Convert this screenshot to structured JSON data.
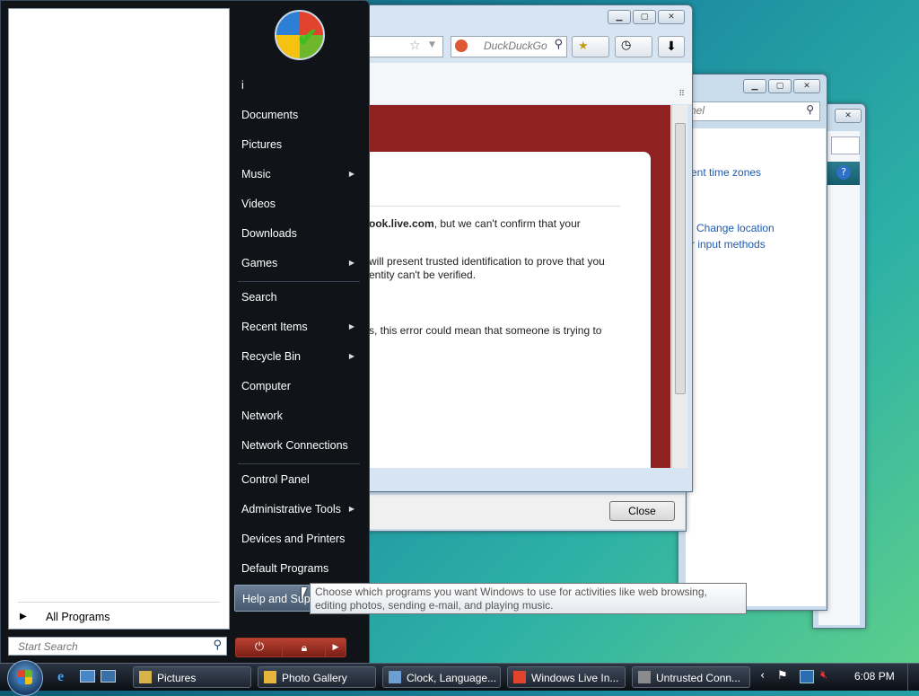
{
  "browser": {
    "search_placeholder": "DuckDuckGo",
    "cert_text_1_bold": "ook.live.com",
    "cert_text_1_rest": ", but we can't confirm that your",
    "cert_text_2": "will present trusted identification to prove that you",
    "cert_text_3": "entity can't be verified.",
    "cert_text_4": "s, this error could mean that someone is trying to"
  },
  "dialog": {
    "search_hint": "nel",
    "link_timezones": "ent time zones",
    "link_change_location": "Change location",
    "link_input_methods": "r input methods",
    "close_label": "Close"
  },
  "start_menu": {
    "user": "i",
    "items": [
      {
        "label": "Documents",
        "arrow": false
      },
      {
        "label": "Pictures",
        "arrow": false
      },
      {
        "label": "Music",
        "arrow": true
      },
      {
        "label": "Videos",
        "arrow": false
      },
      {
        "label": "Downloads",
        "arrow": false
      },
      {
        "label": "Games",
        "arrow": true
      },
      {
        "label": "Search",
        "arrow": false
      },
      {
        "label": "Recent Items",
        "arrow": true
      },
      {
        "label": "Recycle Bin",
        "arrow": true
      },
      {
        "label": "Computer",
        "arrow": false
      },
      {
        "label": "Network",
        "arrow": false
      },
      {
        "label": "Network Connections",
        "arrow": false
      },
      {
        "label": "Control Panel",
        "arrow": false
      },
      {
        "label": "Administrative Tools",
        "arrow": true
      },
      {
        "label": "Devices and Printers",
        "arrow": false
      },
      {
        "label": "Default Programs",
        "arrow": false
      },
      {
        "label": "Help and Support",
        "arrow": false
      }
    ],
    "all_programs": "All Programs",
    "search_placeholder": "Start Search"
  },
  "tooltip": "Choose which programs you want Windows to use for activities like web browsing, editing photos, sending e-mail, and playing music.",
  "taskbar": {
    "buttons": [
      "Pictures",
      "Photo Gallery",
      "Clock, Language...",
      "Windows Live In...",
      "Untrusted Conn..."
    ],
    "clock": "6:08 PM"
  }
}
